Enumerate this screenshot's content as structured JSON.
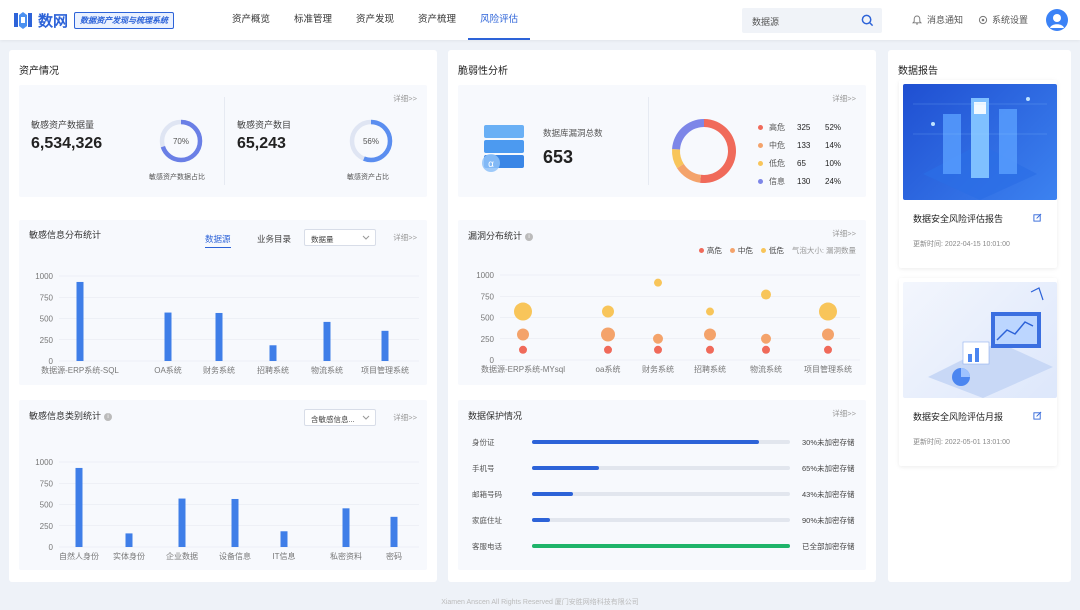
{
  "app": {
    "name": "数网",
    "tagline": "数据资产发现与梳理系统"
  },
  "nav": [
    {
      "label": "资产概览",
      "active": false
    },
    {
      "label": "标准管理",
      "active": false
    },
    {
      "label": "资产发现",
      "active": false
    },
    {
      "label": "资产梳理",
      "active": false
    },
    {
      "label": "风险评估",
      "active": true
    }
  ],
  "header": {
    "search_placeholder": "数据源",
    "notifications": "消息通知",
    "settings": "系统设置"
  },
  "asset": {
    "title": "资产情况",
    "more": "详细>>",
    "data_volume": {
      "label": "敏感资产数据量",
      "value": "6,534,326",
      "ratio_label": "70%",
      "ratio": 0.7,
      "caption": "敏感资产数据占比"
    },
    "count": {
      "label": "敏感资产数目",
      "value": "65,243",
      "ratio_label": "56%",
      "ratio": 0.56,
      "caption": "敏感资产占比"
    }
  },
  "distribution": {
    "title": "敏感信息分布统计",
    "tabs": [
      "数据源",
      "业务目录"
    ],
    "select": "数据量",
    "more": "详细>>"
  },
  "category": {
    "title": "敏感信息类别统计",
    "select": "含敏感信息...",
    "more": "详细>>"
  },
  "vuln": {
    "title": "脆弱性分析",
    "more": "详细>>",
    "total_label": "数据库漏洞总数",
    "total": "653",
    "db_icon_letter": "α",
    "legend": [
      {
        "name": "高危",
        "count": "325",
        "pct": "52%",
        "value": 52,
        "color": "#f06a5a"
      },
      {
        "name": "中危",
        "count": "133",
        "pct": "14%",
        "value": 14,
        "color": "#f4a36b"
      },
      {
        "name": "低危",
        "count": "65",
        "pct": "10%",
        "value": 10,
        "color": "#f8c55a"
      },
      {
        "name": "信息",
        "count": "130",
        "pct": "24%",
        "value": 24,
        "color": "#7d86e8"
      }
    ]
  },
  "vuln_dist": {
    "title": "漏洞分布统计",
    "more": "详细>>",
    "legend": [
      {
        "name": "高危",
        "color": "#f06a5a"
      },
      {
        "name": "中危",
        "color": "#f4a36b"
      },
      {
        "name": "低危",
        "color": "#f8c55a"
      }
    ],
    "size_note": "气泡大小: 漏洞数量"
  },
  "protection": {
    "title": "数据保护情况",
    "more": "详细>>",
    "rows": [
      {
        "label": "身份证",
        "value": 0.88,
        "text": "30%未加密存储",
        "color": "#2d63d8"
      },
      {
        "label": "手机号",
        "value": 0.26,
        "text": "65%未加密存储",
        "color": "#2d63d8"
      },
      {
        "label": "邮箱号码",
        "value": 0.16,
        "text": "43%未加密存储",
        "color": "#2d63d8"
      },
      {
        "label": "家庭住址",
        "value": 0.07,
        "text": "90%未加密存储",
        "color": "#2d63d8"
      },
      {
        "label": "客服电话",
        "value": 1.0,
        "text": "已全部加密存储",
        "color": "#1fb46a"
      }
    ]
  },
  "reports": {
    "title": "数据报告",
    "items": [
      {
        "title": "数据安全风险评估报告",
        "time": "更新时间: 2022-04-15 10:01:00"
      },
      {
        "title": "数据安全风险评估月报",
        "time": "更新时间: 2022-05-01 13:01:00"
      }
    ]
  },
  "footer": "Xiamen Anscen All Rights Reserved 厦门安胜网络科技有限公司",
  "chart_data": [
    {
      "type": "bar",
      "title": "敏感信息分布统计",
      "categories": [
        "数据源-ERP系统-SQL",
        "OA系统",
        "财务系统",
        "招聘系统",
        "物流系统",
        "项目管理系统"
      ],
      "values": [
        930,
        570,
        565,
        185,
        460,
        355
      ],
      "ylim": [
        0,
        1000
      ],
      "yticks": [
        0,
        250,
        500,
        750,
        1000
      ],
      "color": "#3f7ee8"
    },
    {
      "type": "bar",
      "title": "敏感信息类别统计",
      "categories": [
        "自然人身份",
        "实体身份",
        "企业数据",
        "设备信息",
        "IT信息",
        "私密资料",
        "密码"
      ],
      "values": [
        930,
        160,
        570,
        565,
        185,
        455,
        355
      ],
      "ylim": [
        0,
        1000
      ],
      "yticks": [
        0,
        250,
        500,
        750,
        1000
      ],
      "color": "#3f7ee8"
    },
    {
      "type": "scatter",
      "title": "漏洞分布统计",
      "categories": [
        "数据源-ERP系统-MYsql",
        "oa系统",
        "财务系统",
        "招聘系统",
        "物流系统",
        "项目管理系统"
      ],
      "ylim": [
        0,
        1000
      ],
      "yticks": [
        0,
        250,
        500,
        750,
        1000
      ],
      "series": [
        {
          "name": "高危",
          "color": "#f06a5a",
          "values": [
            120,
            120,
            120,
            120,
            120,
            120
          ],
          "sizes": [
            4,
            4,
            4,
            4,
            4,
            4
          ]
        },
        {
          "name": "中危",
          "color": "#f4a36b",
          "values": [
            300,
            300,
            250,
            300,
            250,
            300
          ],
          "sizes": [
            6,
            7,
            5,
            6,
            5,
            6
          ]
        },
        {
          "name": "低危",
          "color": "#f8c55a",
          "values": [
            570,
            570,
            910,
            570,
            770,
            570
          ],
          "sizes": [
            9,
            6,
            4,
            4,
            5,
            9
          ]
        }
      ]
    },
    {
      "type": "pie",
      "title": "脆弱性分析",
      "categories": [
        "高危",
        "中危",
        "低危",
        "信息"
      ],
      "values": [
        52,
        14,
        10,
        24
      ]
    }
  ]
}
